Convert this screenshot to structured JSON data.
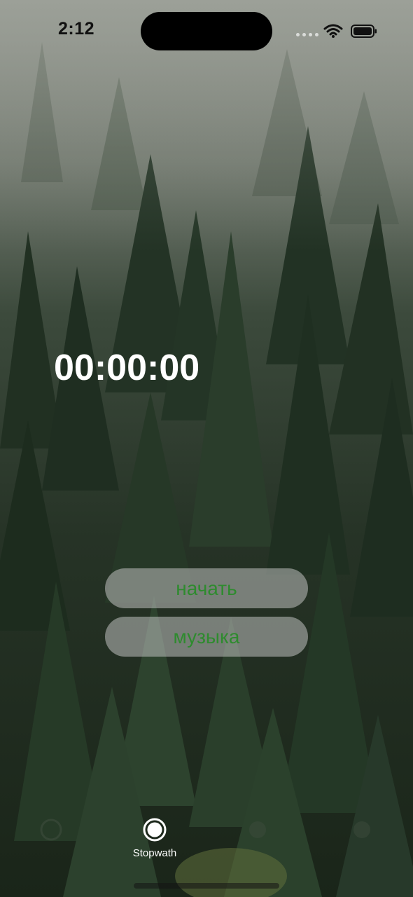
{
  "status_bar": {
    "time": "2:12",
    "icons": [
      "cellular-signal-icon",
      "wifi-icon",
      "battery-icon"
    ]
  },
  "stopwatch": {
    "display": "00:00:00"
  },
  "buttons": {
    "start_label": "начать",
    "music_label": "музыка"
  },
  "tab_bar": {
    "tabs": [
      {
        "label": "",
        "icon": "tab-icon",
        "selected": false
      },
      {
        "label": "Stopwath",
        "icon": "record-circle-icon",
        "selected": true
      },
      {
        "label": "",
        "icon": "tab-icon",
        "selected": false
      },
      {
        "label": "",
        "icon": "tab-icon",
        "selected": false
      }
    ]
  },
  "colors": {
    "button_text": "#2e8b2e",
    "timer_text": "#ffffff",
    "button_fill": "rgba(200,200,200,0.52)"
  }
}
